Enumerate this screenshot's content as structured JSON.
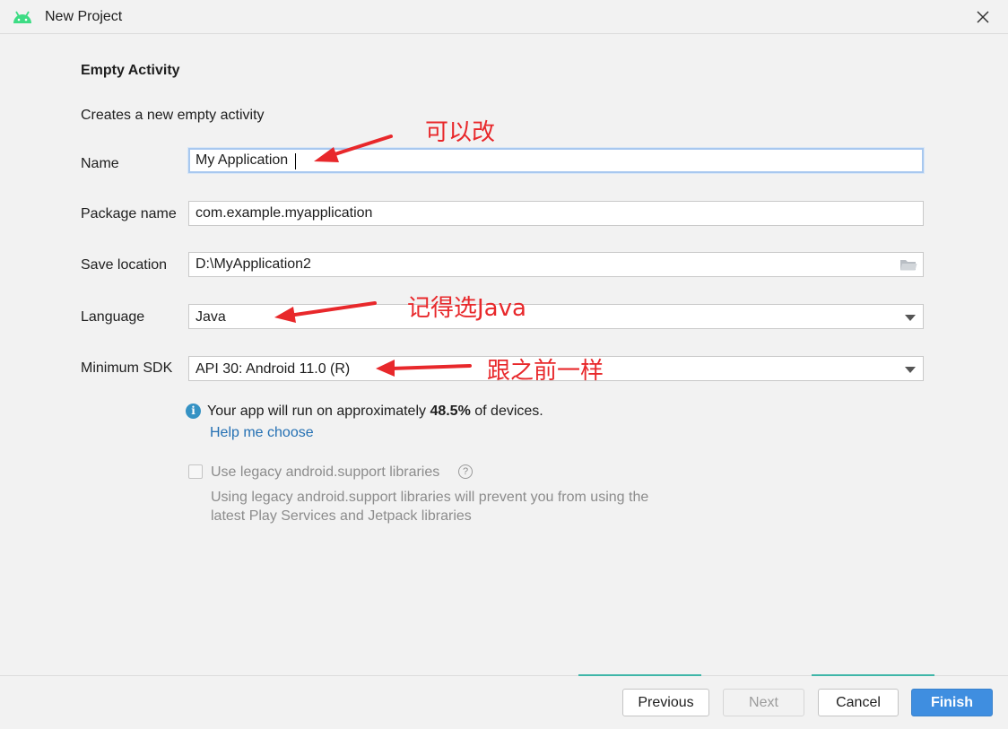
{
  "window": {
    "title": "New Project",
    "close_icon": "close-icon",
    "app_icon": "android-icon"
  },
  "form": {
    "heading": "Empty Activity",
    "description": "Creates a new empty activity",
    "name": {
      "label": "Name",
      "value": "My Application"
    },
    "package": {
      "label": "Package name",
      "value": "com.example.myapplication"
    },
    "save_location": {
      "label": "Save location",
      "value": "D:\\MyApplication2",
      "icon": "folder-icon"
    },
    "language": {
      "label": "Language",
      "value": "Java"
    },
    "min_sdk": {
      "label": "Minimum SDK",
      "value": "API 30: Android 11.0 (R)"
    }
  },
  "info": {
    "text_before": "Your app will run on approximately ",
    "percentage": "48.5%",
    "text_after": " of devices.",
    "help_link": "Help me choose"
  },
  "legacy": {
    "checked": false,
    "label": "Use legacy android.support libraries",
    "description": "Using legacy android.support libraries will prevent you from using the latest Play Services and Jetpack libraries"
  },
  "buttons": {
    "previous": "Previous",
    "next": "Next",
    "cancel": "Cancel",
    "finish": "Finish"
  },
  "annotations": {
    "name_note": "可以改",
    "language_note": "记得选Java",
    "sdk_note": "跟之前一样",
    "color": "#e8282b"
  },
  "colors": {
    "accent": "#3f8ee0",
    "link": "#2470b3",
    "android_green": "#3ddc84"
  }
}
